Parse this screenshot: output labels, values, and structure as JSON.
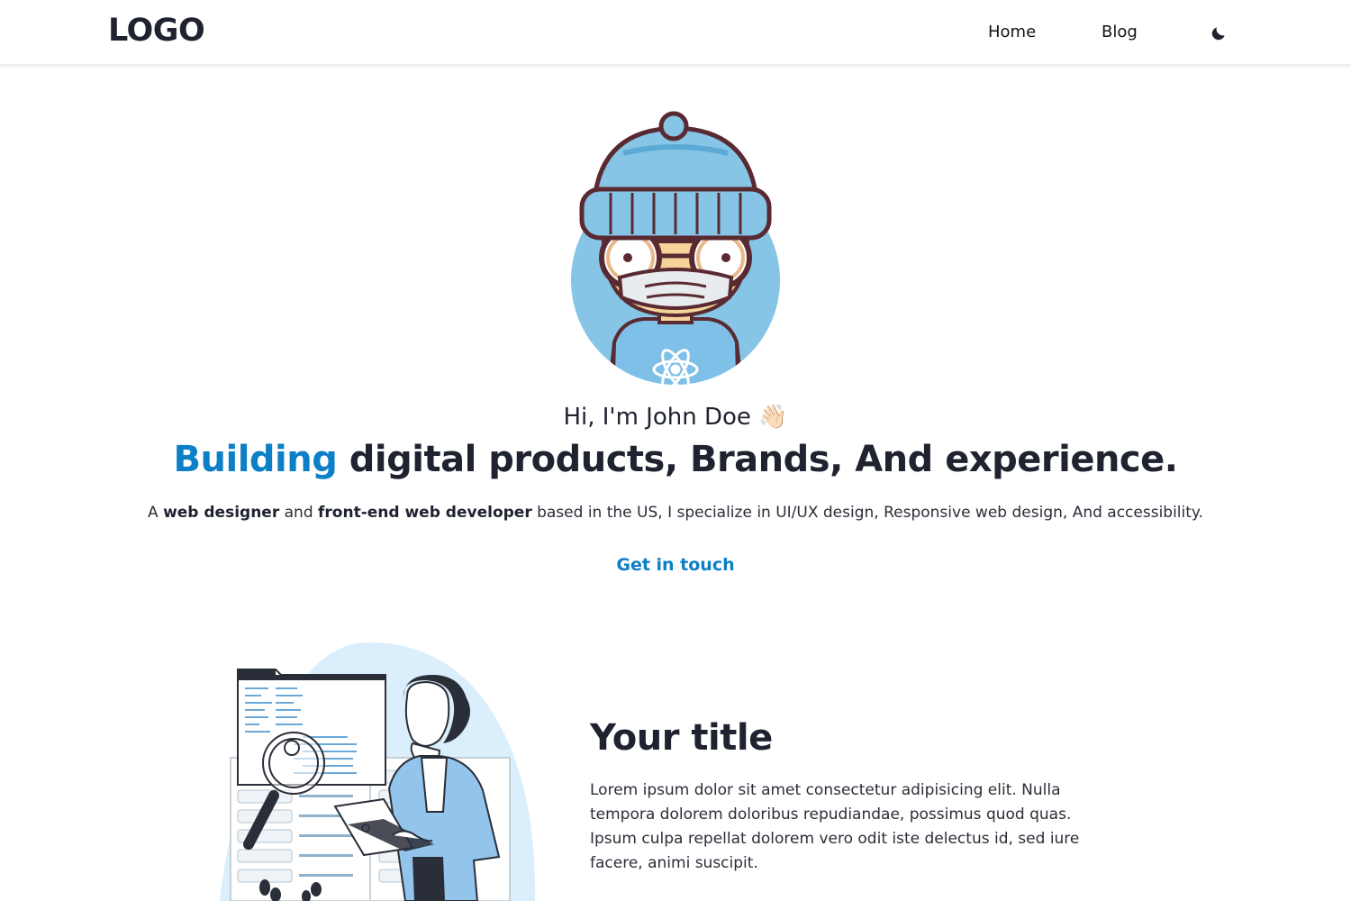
{
  "navbar": {
    "logo": "LOGO",
    "links": [
      {
        "label": "Home"
      },
      {
        "label": "Blog"
      }
    ],
    "theme_icon": "moon-icon"
  },
  "hero": {
    "avatar_icon": "developer-avatar-illustration",
    "greeting": "Hi, I'm John Doe",
    "greeting_emoji": "👋🏻",
    "headline_accent": "Building",
    "headline_rest": " digital products, Brands, And experience.",
    "intro_prefix": "A ",
    "intro_role1": "web designer",
    "intro_mid": " and ",
    "intro_role2": "front-end web developer",
    "intro_suffix": " based in the US, I specialize in UI/UX design, Responsive web design, And accessibility.",
    "cta_label": "Get in touch"
  },
  "feature": {
    "illustration_icon": "developer-searching-code-illustration",
    "title": "Your title",
    "text": "Lorem ipsum dolor sit amet consectetur adipisicing elit. Nulla tempora dolorem doloribus repudiandae, possimus quod quas. Ipsum culpa repellat dolorem vero odit iste delectus id, sed iure facere, animi suscipit."
  },
  "colors": {
    "accent": "#0c7fc6",
    "text": "#1f2330",
    "avatar_bg": "#86c5e6",
    "blob": "#dbeefc"
  }
}
